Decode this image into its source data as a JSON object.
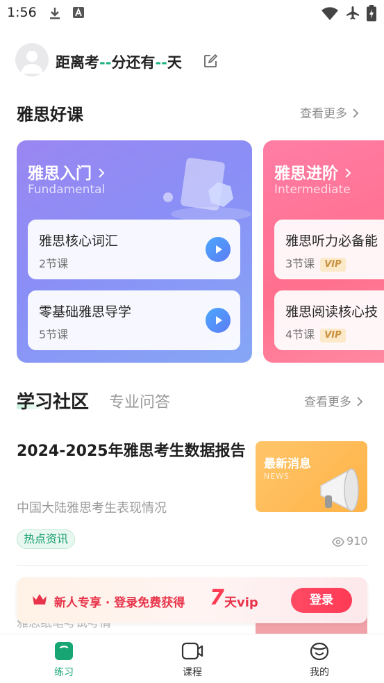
{
  "status_bar": {
    "time": "1:56"
  },
  "header": {
    "pre": "距离考",
    "dash1": "--",
    "mid": "分还有",
    "dash2": "--",
    "post": "天"
  },
  "courses_section": {
    "title": "雅思好课",
    "more": "查看更多"
  },
  "course_cards": [
    {
      "title": "雅思入门",
      "subtitle": "Fundamental",
      "lessons": [
        {
          "name": "雅思核心词汇",
          "count": "2节课"
        },
        {
          "name": "零基础雅思导学",
          "count": "5节课"
        }
      ]
    },
    {
      "title": "雅思进阶",
      "subtitle": "Intermediate",
      "lessons": [
        {
          "name": "雅思听力必备能",
          "count": "3节课",
          "badge": "VIP"
        },
        {
          "name": "雅思阅读核心技",
          "count": "4节课",
          "badge": "VIP"
        }
      ]
    }
  ],
  "community": {
    "tab_active": "学习社区",
    "tab_inactive": "专业问答",
    "more": "查看更多"
  },
  "article": {
    "title": "2024-2025年雅思考生数据报告",
    "subtitle": "中国大陆雅思考生表现情况",
    "thumb_title": "最新消息",
    "thumb_sub": "NEWS",
    "tag": "热点资讯",
    "views": "910"
  },
  "next_article": {
    "subtitle": "雅思纸笔考试考情"
  },
  "banner": {
    "text": "新人专享 · 登录免费获得",
    "seven": "7",
    "suffix": "天vip",
    "button": "登录"
  },
  "bottom_nav": [
    {
      "label": "练习",
      "active": true
    },
    {
      "label": "课程",
      "active": false
    },
    {
      "label": "我的",
      "active": false
    }
  ],
  "colors": {
    "accent_green": "#16a673",
    "card_purple": "#8a8ff6",
    "card_pink": "#ff6f8e",
    "promo_red": "#e8344a"
  }
}
